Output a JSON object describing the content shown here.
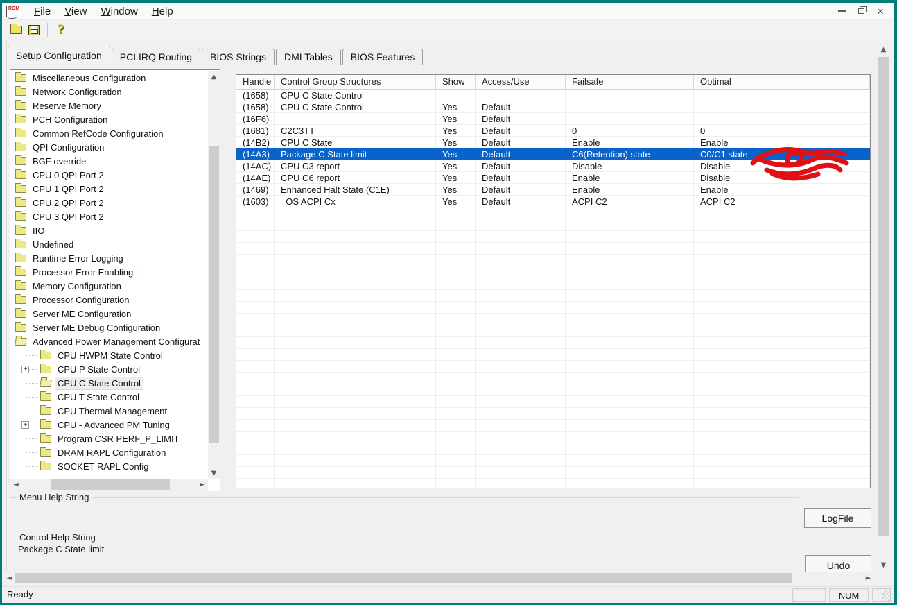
{
  "window": {
    "icon_text": "ROM",
    "menus": [
      "File",
      "View",
      "Window",
      "Help"
    ]
  },
  "toolbar": {
    "icons": [
      "open-file",
      "save-file",
      "help"
    ]
  },
  "tabs": {
    "active": 0,
    "items": [
      "Setup Configuration",
      "PCI IRQ Routing",
      "BIOS Strings",
      "DMI Tables",
      "BIOS Features"
    ]
  },
  "tree": {
    "items": [
      {
        "label": "Miscellaneous Configuration",
        "level": 0
      },
      {
        "label": "Network Configuration",
        "level": 0
      },
      {
        "label": "Reserve Memory",
        "level": 0
      },
      {
        "label": "PCH Configuration",
        "level": 0
      },
      {
        "label": "Common RefCode Configuration",
        "level": 0
      },
      {
        "label": "QPI Configuration",
        "level": 0
      },
      {
        "label": "BGF override",
        "level": 0
      },
      {
        "label": "CPU 0 QPI Port 2",
        "level": 0
      },
      {
        "label": "CPU 1 QPI Port 2",
        "level": 0
      },
      {
        "label": "CPU 2 QPI Port 2",
        "level": 0
      },
      {
        "label": "CPU 3 QPI Port 2",
        "level": 0
      },
      {
        "label": "IIO",
        "level": 0
      },
      {
        "label": "Undefined",
        "level": 0
      },
      {
        "label": "Runtime Error Logging",
        "level": 0
      },
      {
        "label": "Processor Error Enabling :",
        "level": 0
      },
      {
        "label": "Memory Configuration",
        "level": 0
      },
      {
        "label": "Processor Configuration",
        "level": 0
      },
      {
        "label": "Server ME Configuration",
        "level": 0
      },
      {
        "label": "Server ME Debug Configuration",
        "level": 0
      },
      {
        "label": "Advanced Power Management Configurat",
        "level": 0,
        "open": true
      },
      {
        "label": "CPU HWPM State Control",
        "level": 1
      },
      {
        "label": "CPU P State Control",
        "level": 1,
        "expand": "+"
      },
      {
        "label": "CPU C State Control",
        "level": 1,
        "selected": true,
        "open": true
      },
      {
        "label": "CPU T State Control",
        "level": 1
      },
      {
        "label": "CPU Thermal Management",
        "level": 1
      },
      {
        "label": "CPU - Advanced PM Tuning",
        "level": 1,
        "expand": "+"
      },
      {
        "label": "Program CSR PERF_P_LIMIT",
        "level": 1
      },
      {
        "label": "DRAM RAPL Configuration",
        "level": 1
      },
      {
        "label": "SOCKET RAPL Config",
        "level": 1
      }
    ]
  },
  "table": {
    "columns": [
      "Handle",
      "Control Group Structures",
      "Show",
      "Access/Use",
      "Failsafe",
      "Optimal"
    ],
    "rows": [
      {
        "handle": "(1658)",
        "name": "CPU C State Control",
        "show": "",
        "access": "",
        "failsafe": "",
        "optimal": ""
      },
      {
        "handle": "(1658)",
        "name": "CPU C State Control",
        "show": "Yes",
        "access": "Default",
        "failsafe": "",
        "optimal": ""
      },
      {
        "handle": "(16F6)",
        "name": "",
        "show": "Yes",
        "access": "Default",
        "failsafe": "",
        "optimal": ""
      },
      {
        "handle": "(1681)",
        "name": "C2C3TT",
        "show": "Yes",
        "access": "Default",
        "failsafe": "0",
        "optimal": "0"
      },
      {
        "handle": "(14B2)",
        "name": "CPU C State",
        "show": "Yes",
        "access": "Default",
        "failsafe": "Enable",
        "optimal": "Enable"
      },
      {
        "handle": "(14A3)",
        "name": "Package C State limit",
        "show": "Yes",
        "access": "Default",
        "failsafe": "C6(Retention) state",
        "optimal": "C0/C1 state",
        "selected": true
      },
      {
        "handle": "(14AC)",
        "name": "CPU C3 report",
        "show": "Yes",
        "access": "Default",
        "failsafe": "Disable",
        "optimal": "Disable"
      },
      {
        "handle": "(14AE)",
        "name": "CPU C6 report",
        "show": "Yes",
        "access": "Default",
        "failsafe": "Enable",
        "optimal": "Disable"
      },
      {
        "handle": "(1469)",
        "name": "Enhanced Halt State (C1E)",
        "show": "Yes",
        "access": "Default",
        "failsafe": "Enable",
        "optimal": "Enable"
      },
      {
        "handle": "(1603)",
        "name": "  OS ACPI Cx",
        "show": "Yes",
        "access": "Default",
        "failsafe": "ACPI C2",
        "optimal": "ACPI C2"
      }
    ]
  },
  "help": {
    "menu_label": "Menu Help String",
    "menu_value": "",
    "control_label": "Control Help String",
    "control_value": "Package C State limit"
  },
  "buttons": {
    "logfile": "LogFile",
    "undo": "Undo"
  },
  "statusbar": {
    "status": "Ready",
    "num": "NUM"
  },
  "annotation": {
    "type": "red-scribble",
    "color": "#e01114"
  },
  "colors": {
    "selection": "#0a63cb",
    "frame": "#007c7c",
    "folder": "#ede886"
  }
}
